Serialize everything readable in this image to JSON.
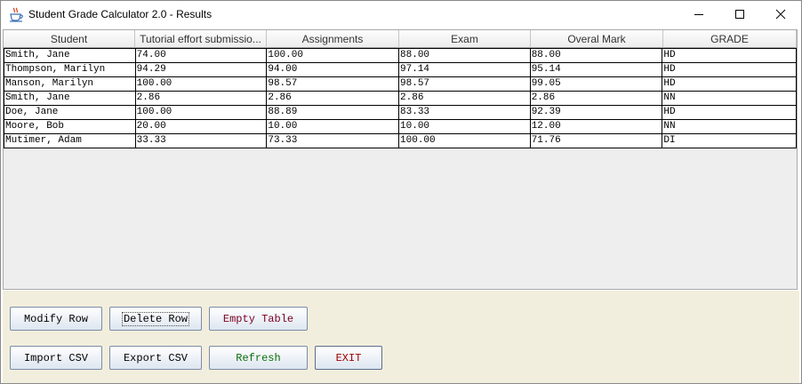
{
  "window": {
    "title": "Student Grade Calculator 2.0 - Results"
  },
  "table": {
    "columns": [
      "Student",
      "Tutorial effort submissio...",
      "Assignments",
      "Exam",
      "Overal Mark",
      "GRADE"
    ],
    "rows": [
      [
        "Smith, Jane",
        "74.00",
        "100.00",
        "88.00",
        "88.00",
        "HD"
      ],
      [
        "Thompson, Marilyn",
        "94.29",
        "94.00",
        "97.14",
        "95.14",
        "HD"
      ],
      [
        "Manson, Marilyn",
        "100.00",
        "98.57",
        "98.57",
        "99.05",
        "HD"
      ],
      [
        "Smith, Jane",
        "2.86",
        "2.86",
        "2.86",
        "2.86",
        "NN"
      ],
      [
        "Doe, Jane",
        "100.00",
        "88.89",
        "83.33",
        "92.39",
        "HD"
      ],
      [
        "Moore, Bob",
        "20.00",
        "10.00",
        "10.00",
        "12.00",
        "NN"
      ],
      [
        "Mutimer, Adam",
        "33.33",
        "73.33",
        "100.00",
        "71.76",
        "DI"
      ]
    ]
  },
  "buttons": {
    "modify_row": "Modify Row",
    "delete_row": "Delete Row",
    "empty_table": "Empty Table",
    "import_csv": "Import CSV",
    "export_csv": "Export CSV",
    "refresh": "Refresh",
    "exit": "EXIT"
  },
  "colors": {
    "empty_table_text": "#7a0020",
    "refresh_text": "#0a6e0a",
    "exit_text": "#a00000",
    "default_text": "#000000"
  },
  "icons": {
    "app": "java-cup-icon",
    "minimize": "minimize-icon",
    "maximize": "maximize-icon",
    "close": "close-icon"
  }
}
